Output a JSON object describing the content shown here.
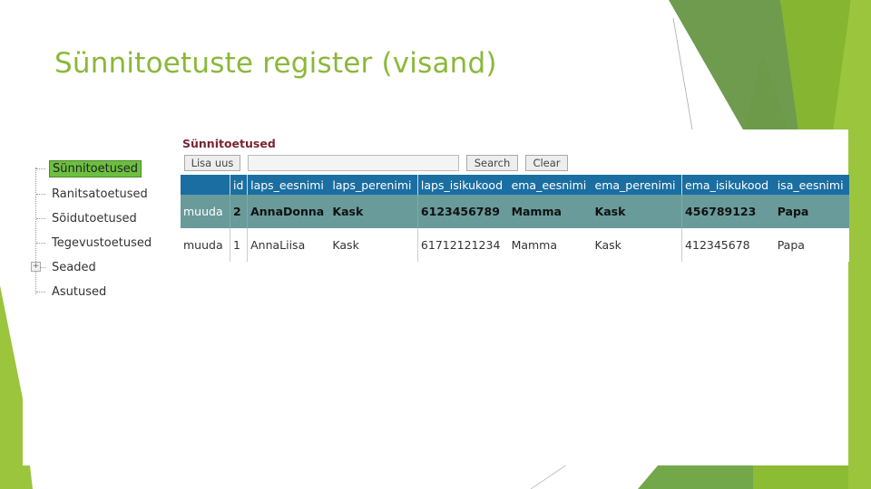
{
  "slide": {
    "title": "Sünnitoetuste register (visand)",
    "colors": {
      "title": "#8bb83a",
      "accent_dark": "#6e9a4e",
      "accent_light": "#9bc53d"
    }
  },
  "tree": {
    "items": [
      {
        "label": "Sünnitoetused",
        "active": true,
        "expandable": false
      },
      {
        "label": "Ranitsatoetused",
        "active": false,
        "expandable": false
      },
      {
        "label": "Sõidutoetused",
        "active": false,
        "expandable": false
      },
      {
        "label": "Tegevustoetused",
        "active": false,
        "expandable": false
      },
      {
        "label": "Seaded",
        "active": false,
        "expandable": true,
        "expander_glyph": "+"
      },
      {
        "label": "Asutused",
        "active": false,
        "expandable": false
      }
    ]
  },
  "main": {
    "heading": "Sünnitoetused",
    "toolbar": {
      "add_label": "Lisa uus",
      "search_value": "",
      "search_label": "Search",
      "clear_label": "Clear"
    },
    "table": {
      "columns": [
        "",
        "id",
        "laps_eesnimi",
        "laps_perenimi",
        "laps_isikukood",
        "ema_eesnimi",
        "ema_perenimi",
        "ema_isikukood",
        "isa_eesnimi"
      ],
      "rows": [
        {
          "selected": true,
          "cells": [
            "muuda",
            "2",
            "AnnaDonna",
            "Kask",
            "6123456789",
            "Mamma",
            "Kask",
            "456789123",
            "Papa"
          ]
        },
        {
          "selected": false,
          "cells": [
            "muuda",
            "1",
            "AnnaLiisa",
            "Kask",
            "61712121234",
            "Mamma",
            "Kask",
            "412345678",
            "Papa"
          ]
        }
      ]
    }
  }
}
